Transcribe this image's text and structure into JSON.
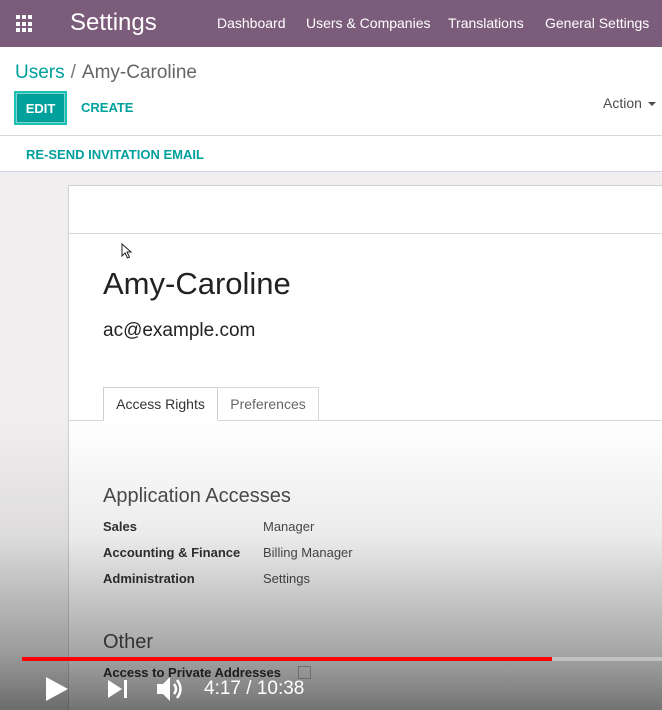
{
  "app": {
    "title": "Settings"
  },
  "nav": {
    "items": [
      "Dashboard",
      "Users & Companies",
      "Translations",
      "General Settings"
    ]
  },
  "breadcrumb": {
    "parent": "Users",
    "separator": "/",
    "current": "Amy-Caroline"
  },
  "toolbar": {
    "edit_label": "EDIT",
    "create_label": "CREATE",
    "action_label": "Action"
  },
  "statusbar": {
    "resend_label": "RE-SEND INVITATION EMAIL"
  },
  "user": {
    "name": "Amy-Caroline",
    "email": "ac@example.com"
  },
  "tabs": [
    {
      "label": "Access Rights",
      "active": true
    },
    {
      "label": "Preferences",
      "active": false
    }
  ],
  "access": {
    "title": "Application Accesses",
    "rows": [
      {
        "label": "Sales",
        "value": "Manager"
      },
      {
        "label": "Accounting & Finance",
        "value": "Billing Manager"
      },
      {
        "label": "Administration",
        "value": "Settings"
      }
    ]
  },
  "other": {
    "title": "Other",
    "private_addresses_label": "Access to Private Addresses",
    "private_addresses_checked": false
  },
  "video": {
    "current_time": "4:17",
    "separator": "/",
    "duration": "10:38",
    "progress": 0.828
  },
  "colors": {
    "topbar": "#7c5c7b",
    "accent": "#00a09d",
    "progress": "#ff0000"
  }
}
